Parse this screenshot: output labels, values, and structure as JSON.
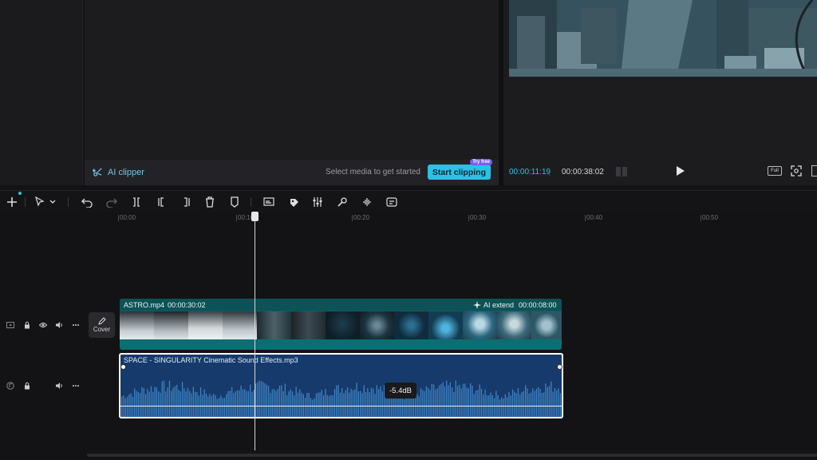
{
  "media_panel": {
    "ai_clipper_label": "AI clipper",
    "select_media_text": "Select media to get started",
    "start_clipping_label": "Start clipping",
    "try_free_badge": "Try free"
  },
  "player": {
    "current_time": "00:00:11:19",
    "separator": "|",
    "total_time": "00:00:38:02",
    "full_label": "Full"
  },
  "toolbar": {
    "icons": [
      "add-icon",
      "select-cursor-icon",
      "chevron-down-icon",
      "undo-icon",
      "redo-icon",
      "split-icon",
      "split-left-icon",
      "split-right-icon",
      "delete-icon",
      "marker-icon",
      "captions-icon",
      "speed-icon",
      "adjust-icon",
      "voice-icon",
      "audio-split-icon",
      "smart-icon"
    ]
  },
  "ruler": {
    "labels": [
      "00:00",
      "00:10",
      "00:20",
      "00:30",
      "00:40",
      "00:50"
    ]
  },
  "tracks": {
    "cover_label": "Cover",
    "video": {
      "name": "ASTRO.mp4",
      "duration": "00:00:30:02",
      "ai_extend_label": "AI extend",
      "ai_extend_duration": "00:00:08:00"
    },
    "audio": {
      "name": "SPACE - SINGULARITY  Cinematic Sound Effects.mp3",
      "volume_badge": "-5.4dB"
    }
  },
  "colors": {
    "accent": "#29c3e3",
    "video_clip": "#0e5f62",
    "audio_clip": "#163a6b",
    "try_free": "#7b5cf5"
  }
}
